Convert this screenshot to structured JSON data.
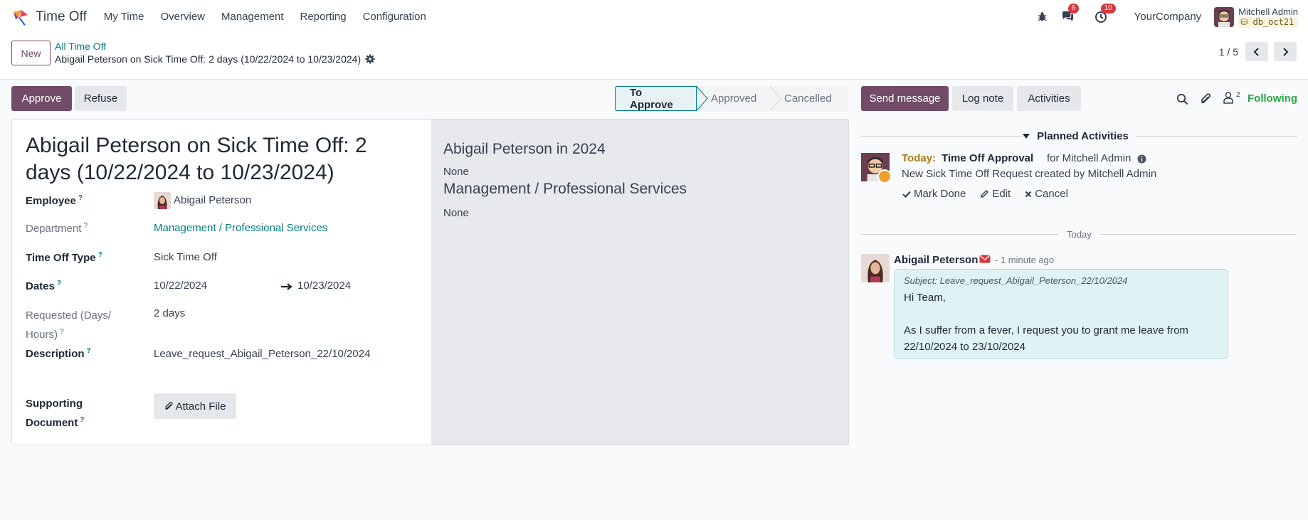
{
  "navbar": {
    "app_name": "Time Off",
    "menu": [
      "My Time",
      "Overview",
      "Management",
      "Reporting",
      "Configuration"
    ],
    "messages_count": "6",
    "activities_count": "10",
    "company": "YourCompany",
    "user_name": "Mitchell Admin",
    "db_name": "db_oct21"
  },
  "control": {
    "new_label": "New",
    "breadcrumb": "All Time Off",
    "record_title": "Abigail Peterson on Sick Time Off: 2 days (10/22/2024 to 10/23/2024)",
    "pager": "1 / 5"
  },
  "statusbar": {
    "approve_label": "Approve",
    "refuse_label": "Refuse",
    "stages": [
      "To Approve",
      "Approved",
      "Cancelled"
    ],
    "active_stage": "To Approve"
  },
  "form": {
    "title": "Abigail Peterson on Sick Time Off: 2 days (10/22/2024 to 10/23/2024)",
    "employee_label": "Employee",
    "employee_value": "Abigail Peterson",
    "department_label": "Department",
    "department_value": "Management / Professional Services",
    "type_label": "Time Off Type",
    "type_value": "Sick Time Off",
    "dates_label": "Dates",
    "date_from": "10/22/2024",
    "date_to": "10/23/2024",
    "requested_label_1": "Requested (Days/",
    "requested_label_2": "Hours)",
    "requested_value": "2 days",
    "description_label": "Description",
    "description_value": "Leave_request_Abigail_Peterson_22/10/2024",
    "supporting_label_1": "Supporting",
    "supporting_label_2": "Document",
    "attach_label": "Attach File",
    "help_mark": "?"
  },
  "side_panel": {
    "heading_1": "Abigail Peterson in 2024",
    "value_1": "None",
    "heading_2": "Management / Professional Services",
    "value_2": "None"
  },
  "chatter": {
    "send_message_label": "Send message",
    "log_note_label": "Log note",
    "activities_label": "Activities",
    "followers_count": "2",
    "following_label": "Following",
    "planned_heading": "Planned Activities",
    "activity": {
      "due": "Today:",
      "type": "Time Off Approval",
      "for": "for Mitchell Admin",
      "note": "New Sick Time Off Request created by Mitchell Admin",
      "mark_done": "Mark Done",
      "edit": "Edit",
      "cancel": "Cancel"
    },
    "day_separator": "Today",
    "message": {
      "author": "Abigail Peterson",
      "time": "- 1 minute ago",
      "subject": "Subject: Leave_request_Abigail_Peterson_22/10/2024",
      "line1": "Hi Team,",
      "line2": "As I suffer from a fever, I request you to grant me leave from",
      "line3": "22/10/2024 to 23/10/2024"
    }
  },
  "colors": {
    "brand": "#714b67",
    "link": "#017e84",
    "following": "#28a745",
    "today": "#b07b10",
    "badge": "#d9363e"
  }
}
